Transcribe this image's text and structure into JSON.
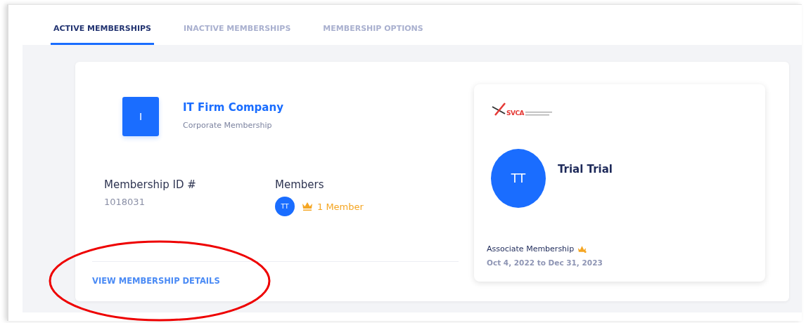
{
  "tabs": [
    {
      "label": "ACTIVE MEMBERSHIPS",
      "selected": true
    },
    {
      "label": "INACTIVE MEMBERSHIPS",
      "selected": false
    },
    {
      "label": "MEMBERSHIP OPTIONS",
      "selected": false
    }
  ],
  "company": {
    "initial": "I",
    "name": "IT Firm Company",
    "membership_type": "Corporate Membership"
  },
  "membership_id": {
    "label": "Membership ID #",
    "value": "1018031"
  },
  "members": {
    "label": "Members",
    "avatar": "TT",
    "count": "1 Member"
  },
  "details_link": "VIEW MEMBERSHIP DETAILS",
  "member_card": {
    "logo_text": "SVCA",
    "avatar": "TT",
    "name": "Trial Trial",
    "membership": "Associate Membership",
    "period": "Oct 4, 2022 to Dec 31, 2023"
  }
}
